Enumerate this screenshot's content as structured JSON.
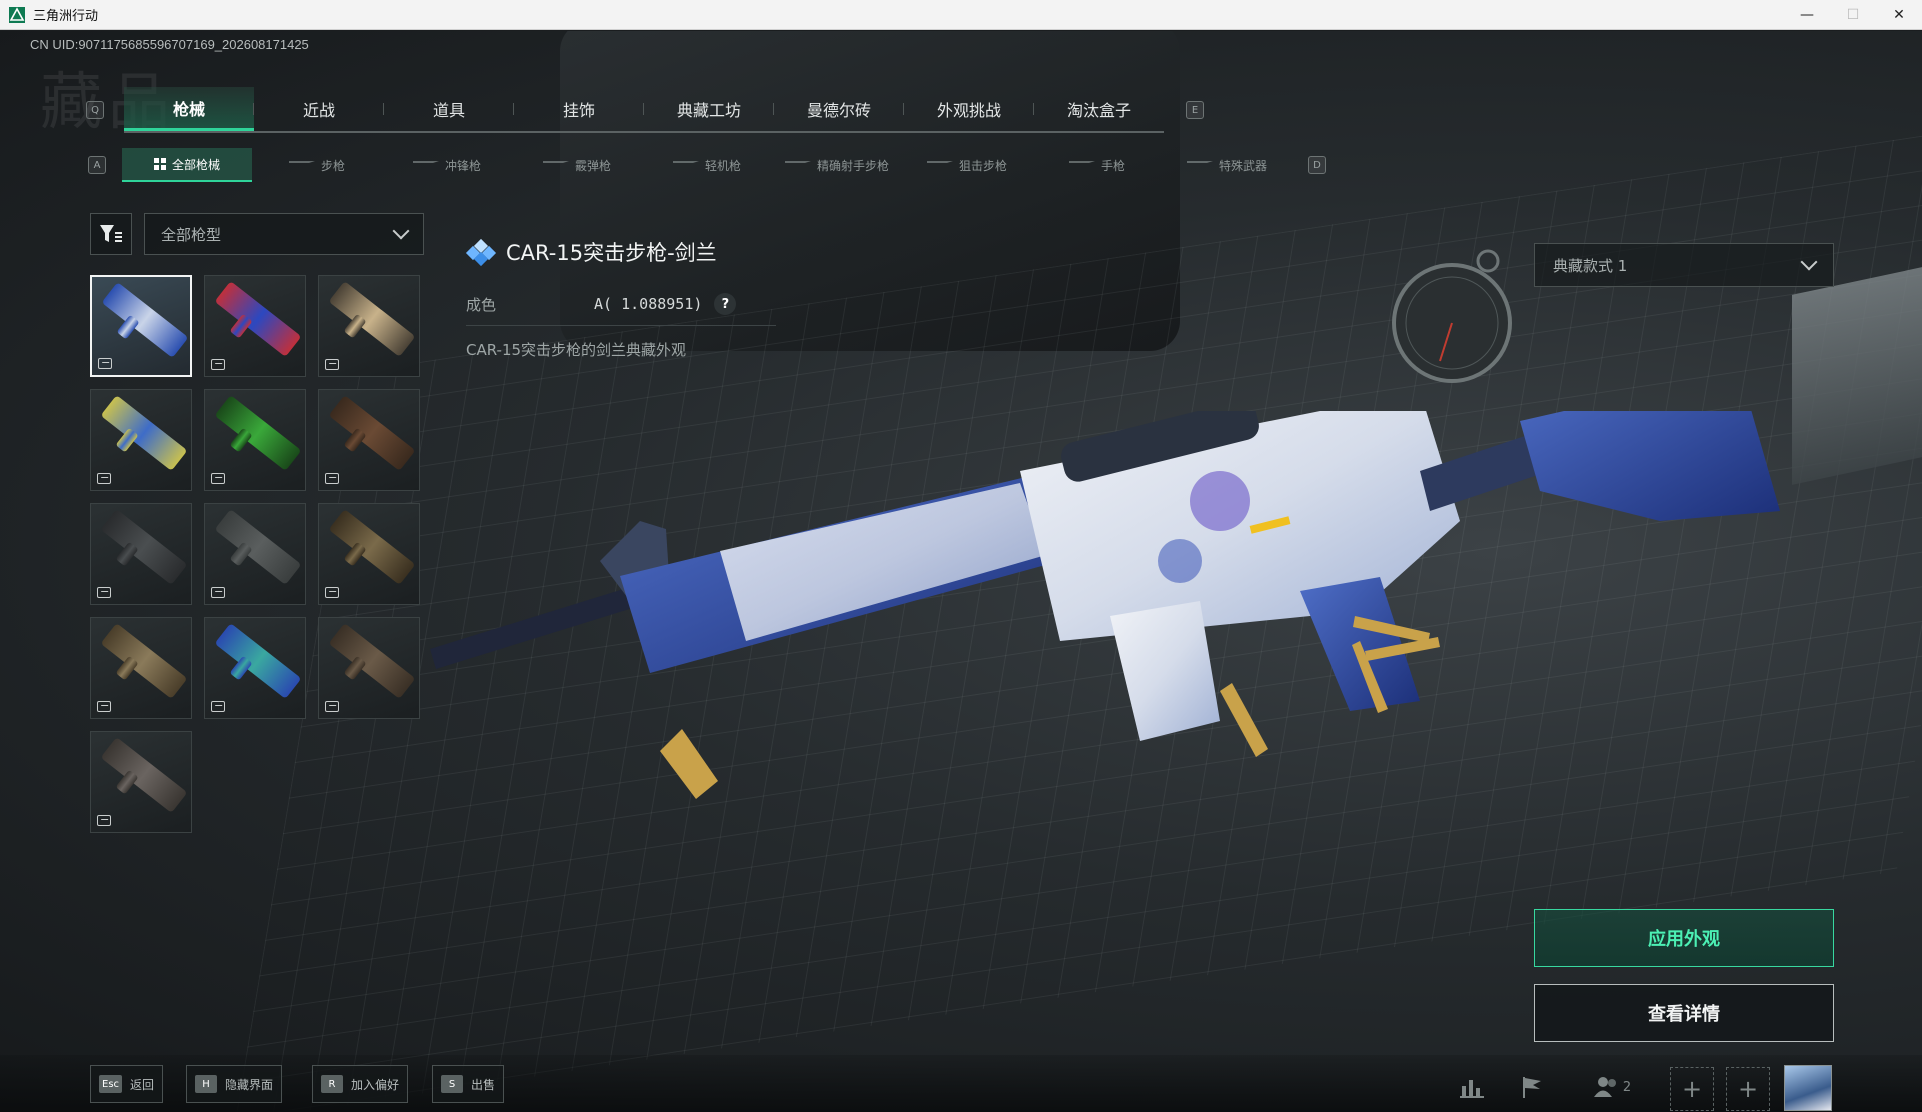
{
  "window": {
    "title": "三角洲行动",
    "controls": {
      "minimize": "—",
      "maximize": "☐",
      "close": "✕"
    }
  },
  "uid_text": "CN UID:9071175685596707169_202608171425",
  "section_watermark": "藏品",
  "main_tabs": {
    "key_left": "Q",
    "key_right": "E",
    "items": [
      {
        "label": "枪械",
        "active": true
      },
      {
        "label": "近战"
      },
      {
        "label": "道具"
      },
      {
        "label": "挂饰"
      },
      {
        "label": "典藏工坊"
      },
      {
        "label": "曼德尔砖"
      },
      {
        "label": "外观挑战"
      },
      {
        "label": "淘汰盒子"
      }
    ]
  },
  "sub_tabs": {
    "key_left": "A",
    "key_right": "D",
    "items": [
      {
        "label": "全部枪械",
        "active": true
      },
      {
        "label": "步枪"
      },
      {
        "label": "冲锋枪"
      },
      {
        "label": "霰弹枪"
      },
      {
        "label": "轻机枪"
      },
      {
        "label": "精确射手步枪"
      },
      {
        "label": "狙击步枪"
      },
      {
        "label": "手枪"
      },
      {
        "label": "特殊武器"
      }
    ]
  },
  "filter": {
    "icon": "filter-icon",
    "type_select": "全部枪型"
  },
  "skins": [
    {
      "color": "#c9d4e8",
      "accent": "#2b4fb0",
      "selected": true
    },
    {
      "color": "#2c48c0",
      "accent": "#c0303c"
    },
    {
      "color": "#c8b28a",
      "accent": "#4a4236"
    },
    {
      "color": "#3e6cc8",
      "accent": "#c8c050"
    },
    {
      "color": "#3aa83a",
      "accent": "#1a4a1a"
    },
    {
      "color": "#6a4a34",
      "accent": "#3a2a1e"
    },
    {
      "color": "#4a4e50",
      "accent": "#2a2c2e"
    },
    {
      "color": "#5a5e5e",
      "accent": "#3a3e3e"
    },
    {
      "color": "#7a6a4a",
      "accent": "#3a3020"
    },
    {
      "color": "#8a7a5a",
      "accent": "#4a3e2a"
    },
    {
      "color": "#3aa8a0",
      "accent": "#2a4ab0"
    },
    {
      "color": "#6a5a48",
      "accent": "#3a3026"
    },
    {
      "color": "#6a6460",
      "accent": "#3a3632"
    }
  ],
  "item": {
    "title": "CAR-15突击步枪-剑兰",
    "condition_label": "成色",
    "condition_value": "A( 1.088951)",
    "help": "?",
    "description": "CAR-15突击步枪的剑兰典藏外观"
  },
  "style_select": "典藏款式 1",
  "actions": {
    "apply": "应用外观",
    "details": "查看详情"
  },
  "bottom_hotkeys": [
    {
      "key": "Esc",
      "label": "返回"
    },
    {
      "key": "H",
      "label": "隐藏界面"
    },
    {
      "key": "R",
      "label": "加入偏好"
    },
    {
      "key": "S",
      "label": "出售"
    }
  ],
  "bottom_right": {
    "stats_icon": "bar-chart-icon",
    "flag_icon": "flag-icon",
    "party_icon": "users-icon",
    "party_count": "2",
    "add_slot": "+"
  },
  "colors": {
    "accent": "#2fd49a",
    "apply_text": "#4cf0b4"
  }
}
